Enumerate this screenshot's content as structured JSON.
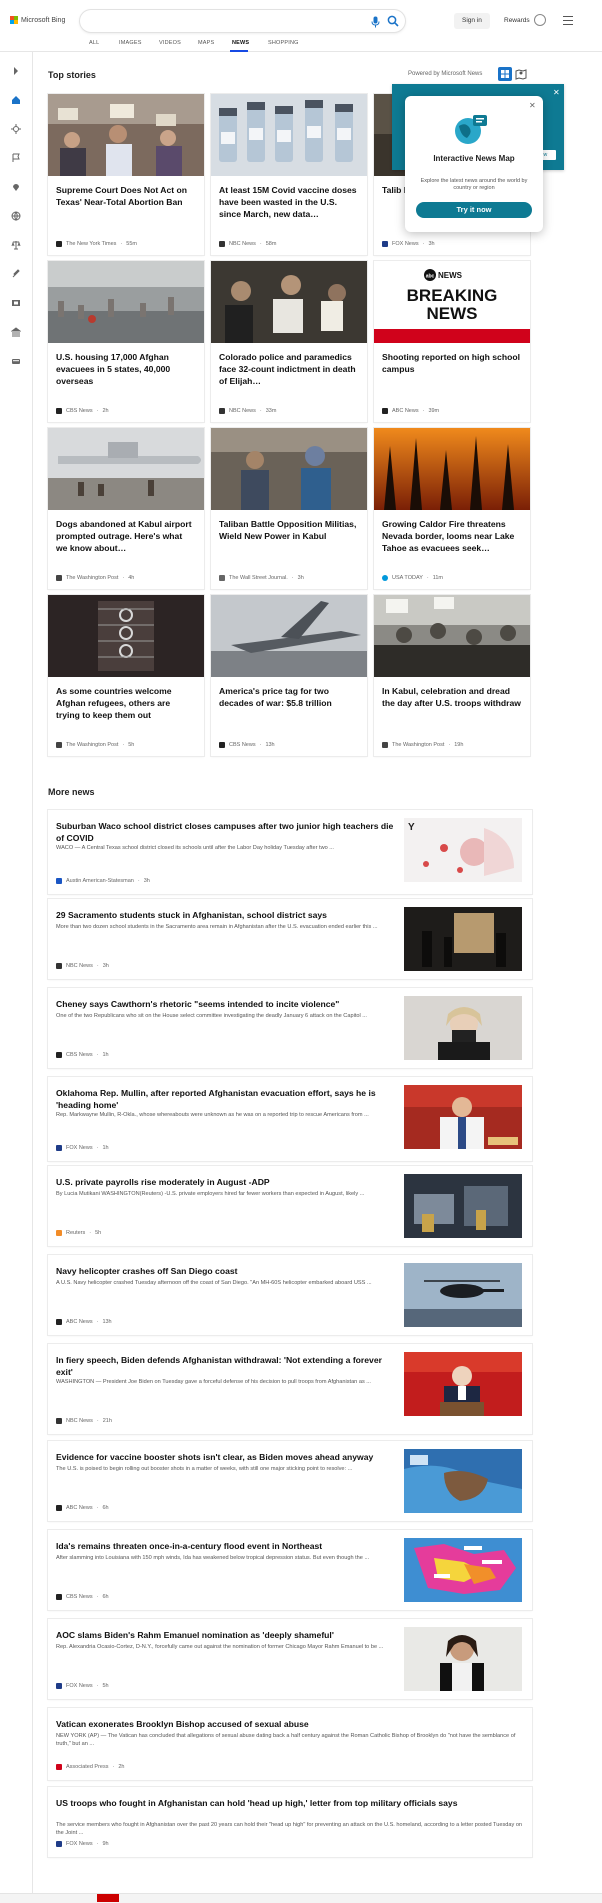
{
  "header": {
    "logo_text": "Microsoft Bing",
    "signin_label": "Sign in",
    "rewards_label": "Rewards"
  },
  "nav": {
    "tabs": [
      "ALL",
      "IMAGES",
      "VIDEOS",
      "MAPS",
      "NEWS",
      "SHOPPING"
    ],
    "active": "NEWS"
  },
  "top_stories": {
    "title": "Top stories",
    "powered_by": "Powered by Microsoft News",
    "cards": [
      {
        "headline": "Supreme Court Does Not Act on Texas' Near-Total Abortion Ban",
        "source": "The New York Times",
        "time": "55m",
        "logo_color": "#222222"
      },
      {
        "headline": "At least 15M Covid vaccine doses have been wasted in the U.S. since March, new data…",
        "source": "NBC News",
        "time": "58m",
        "logo_color": "#333333"
      },
      {
        "headline": "Talib betra non-",
        "source": "FOX News",
        "time": "3h",
        "logo_color": "#1f3c88"
      },
      {
        "headline": "U.S. housing 17,000 Afghan evacuees in 5 states, 40,000 overseas",
        "source": "CBS News",
        "time": "2h",
        "logo_color": "#222222"
      },
      {
        "headline": "Colorado police and paramedics face 32-count indictment in death of Elijah…",
        "source": "NBC News",
        "time": "33m",
        "logo_color": "#333333"
      },
      {
        "headline": "Shooting reported on high school campus",
        "source": "ABC News",
        "time": "39m",
        "logo_color": "#222222"
      },
      {
        "headline": "Dogs abandoned at Kabul airport prompted outrage. Here's what we know about…",
        "source": "The Washington Post",
        "time": "4h",
        "logo_color": "#444444"
      },
      {
        "headline": "Taliban Battle Opposition Militias, Wield New Power in Kabul",
        "source": "The Wall Street Journal.",
        "time": "3h",
        "logo_color": "#666666"
      },
      {
        "headline": "Growing Caldor Fire threatens Nevada border, looms near Lake Tahoe as evacuees seek…",
        "source": "USA TODAY",
        "time": "11m",
        "logo_color": "#0098db"
      },
      {
        "headline": "As some countries welcome Afghan refugees, others are trying to keep them out",
        "source": "The Washington Post",
        "time": "5h",
        "logo_color": "#444444"
      },
      {
        "headline": "America's price tag for two decades of war: $5.8 trillion",
        "source": "CBS News",
        "time": "13h",
        "logo_color": "#222222"
      },
      {
        "headline": "In Kabul, celebration and dread the day after U.S. troops withdraw",
        "source": "The Washington Post",
        "time": "19h",
        "logo_color": "#444444"
      }
    ],
    "breaking_card": {
      "brand": "abc NEWS",
      "line1": "BREAKING",
      "line2": "NEWS"
    }
  },
  "popup": {
    "title": "Interactive News Map",
    "description": "Explore the latest news around the world by country or region",
    "button": "Try it now",
    "panel_button": "ew"
  },
  "more_news": {
    "title": "More news",
    "rows": [
      {
        "headline": "Suburban Waco school district closes campuses after two junior high teachers die of COVID",
        "snippet": "WACO — A Central Texas school district closed its schools until after the Labor Day holiday Tuesday after two ...",
        "source": "Austin American-Statesman",
        "time": "3h",
        "logo_color": "#1a56c4"
      },
      {
        "headline": "29 Sacramento students stuck in Afghanistan, school district says",
        "snippet": "More than two dozen school students in the Sacramento area remain in Afghanistan after the U.S. evacuation ended earlier this ...",
        "source": "NBC News",
        "time": "3h",
        "logo_color": "#333333"
      },
      {
        "headline": "Cheney says Cawthorn's rhetoric \"seems intended to incite violence\"",
        "snippet": "One of the two Republicans who sit on the House select committee investigating the deadly January 6 attack on the Capitol ...",
        "source": "CBS News",
        "time": "1h",
        "logo_color": "#222222"
      },
      {
        "headline": "Oklahoma Rep. Mullin, after reported Afghanistan evacuation effort, says he is 'heading home'",
        "snippet": "Rep. Markwayne Mullin, R-Okla., whose whereabouts were unknown as he was on a reported trip to rescue Americans from ...",
        "source": "FOX News",
        "time": "1h",
        "logo_color": "#1f3c88"
      },
      {
        "headline": "U.S. private payrolls rise moderately in August -ADP",
        "snippet": "By Lucia Mutikani WASHINGTON(Reuters) -U.S. private employers hired far fewer workers than expected in August, likely ...",
        "source": "Reuters",
        "time": "5h",
        "logo_color": "#f28c28"
      },
      {
        "headline": "Navy helicopter crashes off San Diego coast",
        "snippet": "A U.S. Navy helicopter crashed Tuesday afternoon off the coast of San Diego. \"An MH-60S helicopter embarked aboard USS ...",
        "source": "ABC News",
        "time": "13h",
        "logo_color": "#222222"
      },
      {
        "headline": "In fiery speech, Biden defends Afghanistan withdrawal: 'Not extending a forever exit'",
        "snippet": "WASHINGTON — President Joe Biden on Tuesday gave a forceful defense of his decision to pull troops from Afghanistan as ...",
        "source": "NBC News",
        "time": "21h",
        "logo_color": "#333333"
      },
      {
        "headline": "Evidence for vaccine booster shots isn't clear, as Biden moves ahead anyway",
        "snippet": "The U.S. is poised to begin rolling out booster shots in a matter of weeks, with still one major sticking point to resolve: ...",
        "source": "ABC News",
        "time": "6h",
        "logo_color": "#222222"
      },
      {
        "headline": "Ida's remains threaten once-in-a-century flood event in Northeast",
        "snippet": "After slamming into Louisiana with 150 mph winds, Ida has weakened below tropical depression status. But even though the ...",
        "source": "CBS News",
        "time": "6h",
        "logo_color": "#222222"
      },
      {
        "headline": "AOC slams Biden's Rahm Emanuel nomination as 'deeply shameful'",
        "snippet": "Rep. Alexandria Ocasio-Cortez, D-N.Y., forcefully came out against the nomination of former Chicago Mayor Rahm Emanuel to be ...",
        "source": "FOX News",
        "time": "5h",
        "logo_color": "#1f3c88"
      },
      {
        "headline": "Vatican exonerates Brooklyn Bishop accused of sexual abuse",
        "snippet": "NEW YORK (AP) — The Vatican has concluded that allegations of sexual abuse dating back a half century against the Roman Catholic Bishop of Brooklyn do \"not have the semblance of truth,\" but an ...",
        "source": "Associated Press",
        "time": "2h",
        "logo_color": "#d0021b"
      },
      {
        "headline": "US troops who fought in Afghanistan can hold 'head up high,' letter from top military officials says",
        "snippet": "The service members who fought in Afghanistan over the past 20 years can hold their \"head up high\" for preventing an attack on the U.S. homeland, according to a letter posted Tuesday on the Joint ...",
        "source": "FOX News",
        "time": "9h",
        "logo_color": "#1f3c88"
      }
    ]
  },
  "colors": {
    "accent": "#174ae4",
    "teal": "#0e7a93"
  }
}
